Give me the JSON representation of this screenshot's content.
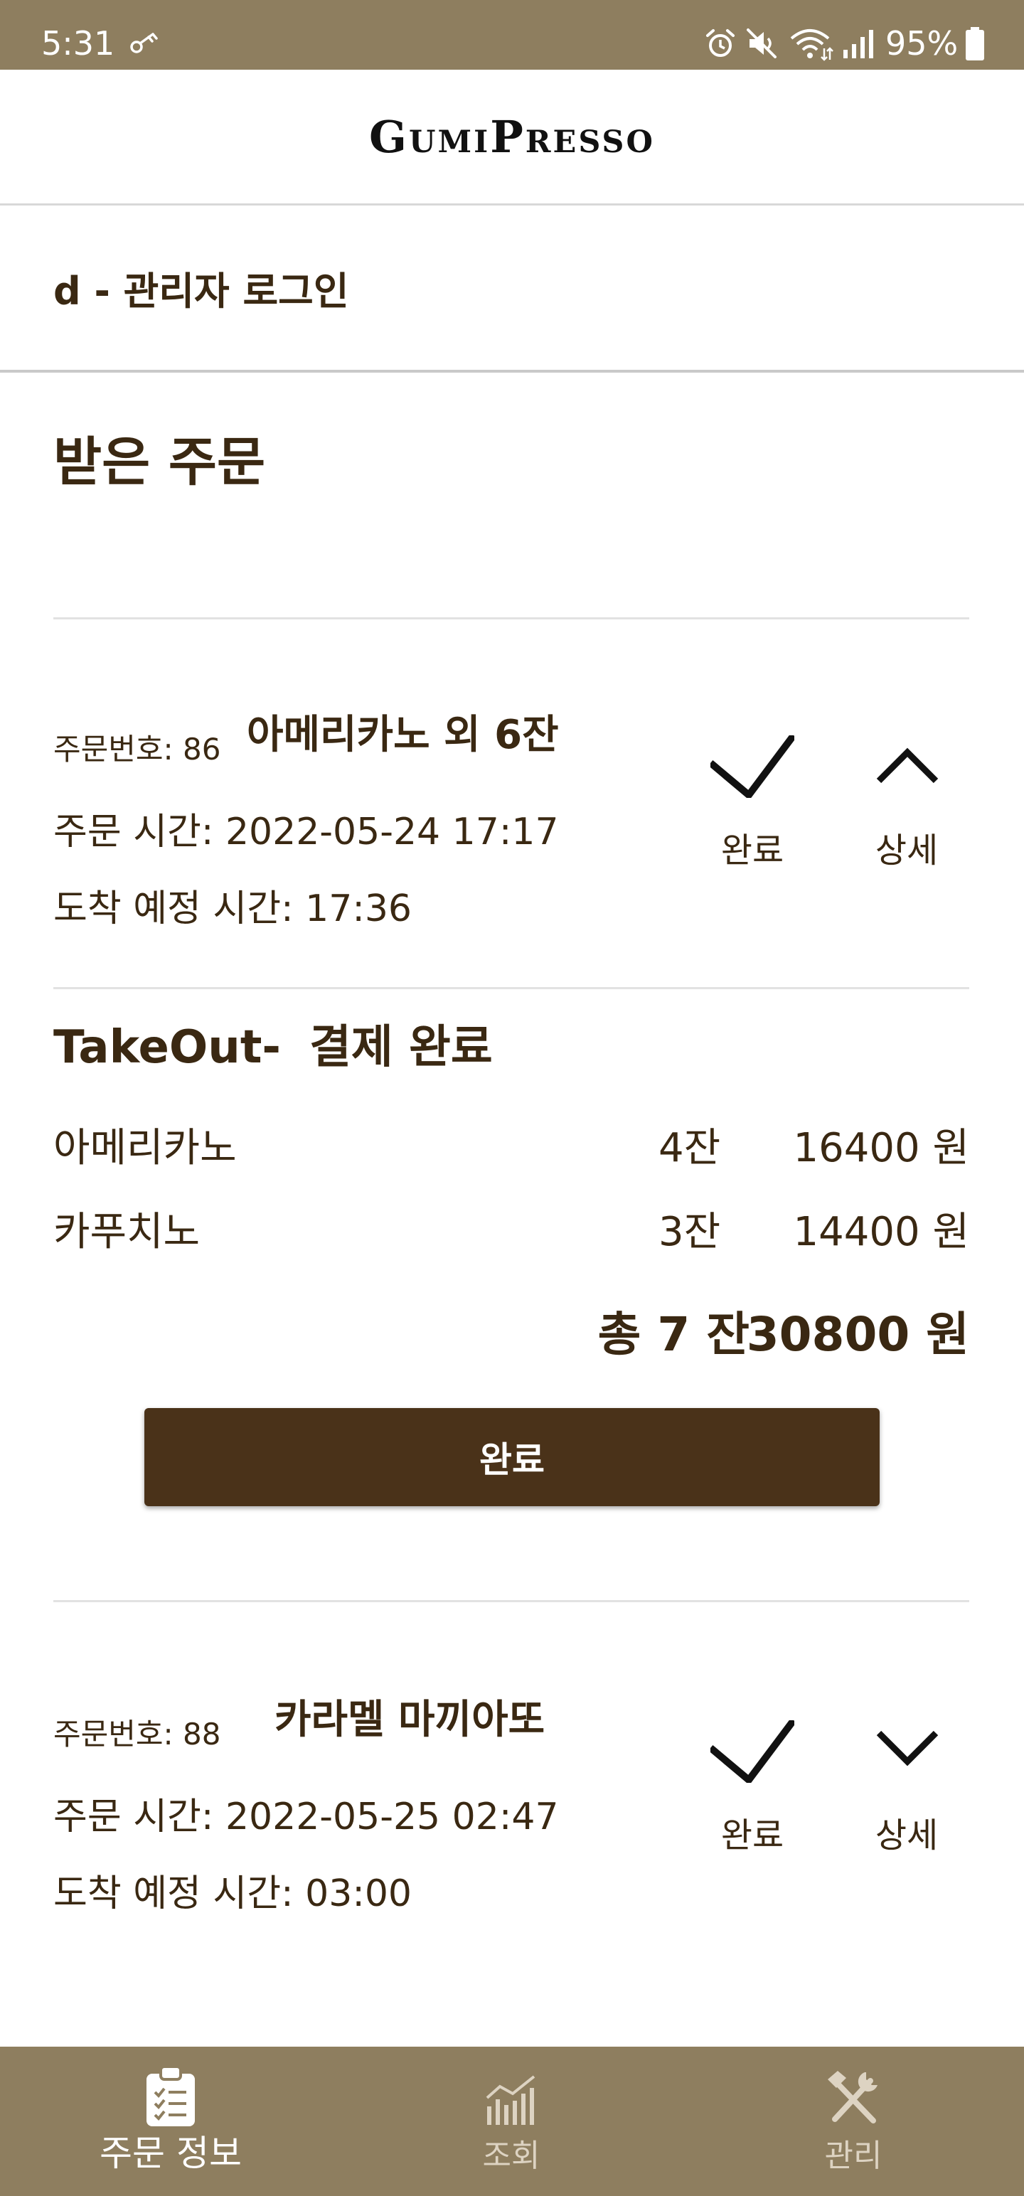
{
  "colors": {
    "status_bar": "#8E7E5F",
    "bottom_nav": "#8E7E5F",
    "button": "#4A3219",
    "text": "#3A2812"
  },
  "status_bar": {
    "time": "5:31",
    "battery": "95%",
    "icons": [
      "vpn-key-icon",
      "alarm-icon",
      "mute-icon",
      "wifi-icon",
      "signal-icon",
      "battery-icon"
    ]
  },
  "header": {
    "title": "GumiPresso"
  },
  "login": {
    "text": "d - 관리자 로그인"
  },
  "section_title": "받은 주문",
  "orders": [
    {
      "number_label": "주문번호: 86",
      "summary": "아메리카노 외 6잔",
      "order_time": "주문 시간: 2022-05-24 17:17",
      "arrival_time": "도착 예정 시간: 17:36",
      "complete_label": "완료",
      "detail_label": "상세",
      "expanded": true,
      "detail": {
        "type": "TakeOut-",
        "payment": "결제 완료",
        "items": [
          {
            "name": "아메리카노",
            "qty": "4잔",
            "price": "16400 원"
          },
          {
            "name": "카푸치노",
            "qty": "3잔",
            "price": "14400 원"
          }
        ],
        "total_qty": "총 7 잔",
        "total_price": "30800 원",
        "complete_button": "완료"
      }
    },
    {
      "number_label": "주문번호: 88",
      "summary": "카라멜 마끼아또",
      "order_time": "주문 시간: 2022-05-25 02:47",
      "arrival_time": "도착 예정 시간: 03:00",
      "complete_label": "완료",
      "detail_label": "상세",
      "expanded": false
    }
  ],
  "bottom_nav": [
    {
      "label": "주문 정보",
      "icon": "clipboard-icon",
      "active": true
    },
    {
      "label": "조회",
      "icon": "chart-icon",
      "active": false
    },
    {
      "label": "관리",
      "icon": "tools-icon",
      "active": false
    }
  ]
}
